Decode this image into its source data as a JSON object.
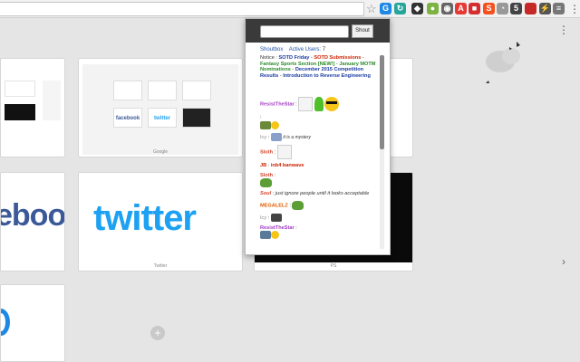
{
  "toolbar": {
    "star_icon": "star-icon",
    "extensions": [
      "shoutbox-extension",
      "extension-2",
      "extension-3",
      "extension-4",
      "extension-5",
      "extension-6",
      "extension-7",
      "extension-8",
      "extension-9",
      "extension-10",
      "extension-11",
      "extension-12",
      "extension-13"
    ],
    "menu_icon": "vertical-dots-icon"
  },
  "popup": {
    "shout_placeholder": "",
    "shout_button": "Shout",
    "nav_shoutbox": "Shoutbox",
    "nav_active_label": "Active Users:",
    "nav_active_count": "7",
    "notice": {
      "label": "Notice :",
      "item1": "SOTD Friday",
      "sep1": " - ",
      "item2": "SOTD Submissions",
      "sep2": " - ",
      "item3": "Fantasy Sports Section [NEW!]",
      "sep3": " - ",
      "item4": "January MOTM Nominations",
      "sep4": " - ",
      "item5": "December 2015 Competition Results",
      "sep5": " - ",
      "item6": "Introduction to Reverse Engineering"
    },
    "messages": [
      {
        "user": "ResistTheStar",
        "sep": " :",
        "text": ""
      },
      {
        "user": "",
        "sep": ":",
        "text": ""
      },
      {
        "user": "Icy",
        "sep": " :",
        "text": "it is a mystery"
      },
      {
        "user": "Sloth",
        "sep": " :",
        "text": ""
      },
      {
        "user": "JB",
        "sep": " :",
        "text": "inb4 banwave"
      },
      {
        "user": "Sloth",
        "sep": " :",
        "text": ""
      },
      {
        "user": "Soul",
        "sep": " :",
        "text": "just ignore people until it looks acceptable"
      },
      {
        "user": "MEGALELZ",
        "sep": " :",
        "text": ""
      },
      {
        "user": "Icy",
        "sep": " :",
        "text": ""
      },
      {
        "user": "ResistTheStar",
        "sep": " :",
        "text": ""
      }
    ]
  },
  "tiles": {
    "google_label": "Google",
    "twitter_label": "Twitter",
    "ps_label": "PS",
    "facebook_mini": "facebook",
    "twitter_mini": "twitter",
    "twitter_big": "twitter",
    "facebook_big": "ebook"
  },
  "colors": {
    "twitter_blue": "#1da1f2",
    "facebook_blue": "#3b5998",
    "popup_header": "#3a3a3a"
  }
}
